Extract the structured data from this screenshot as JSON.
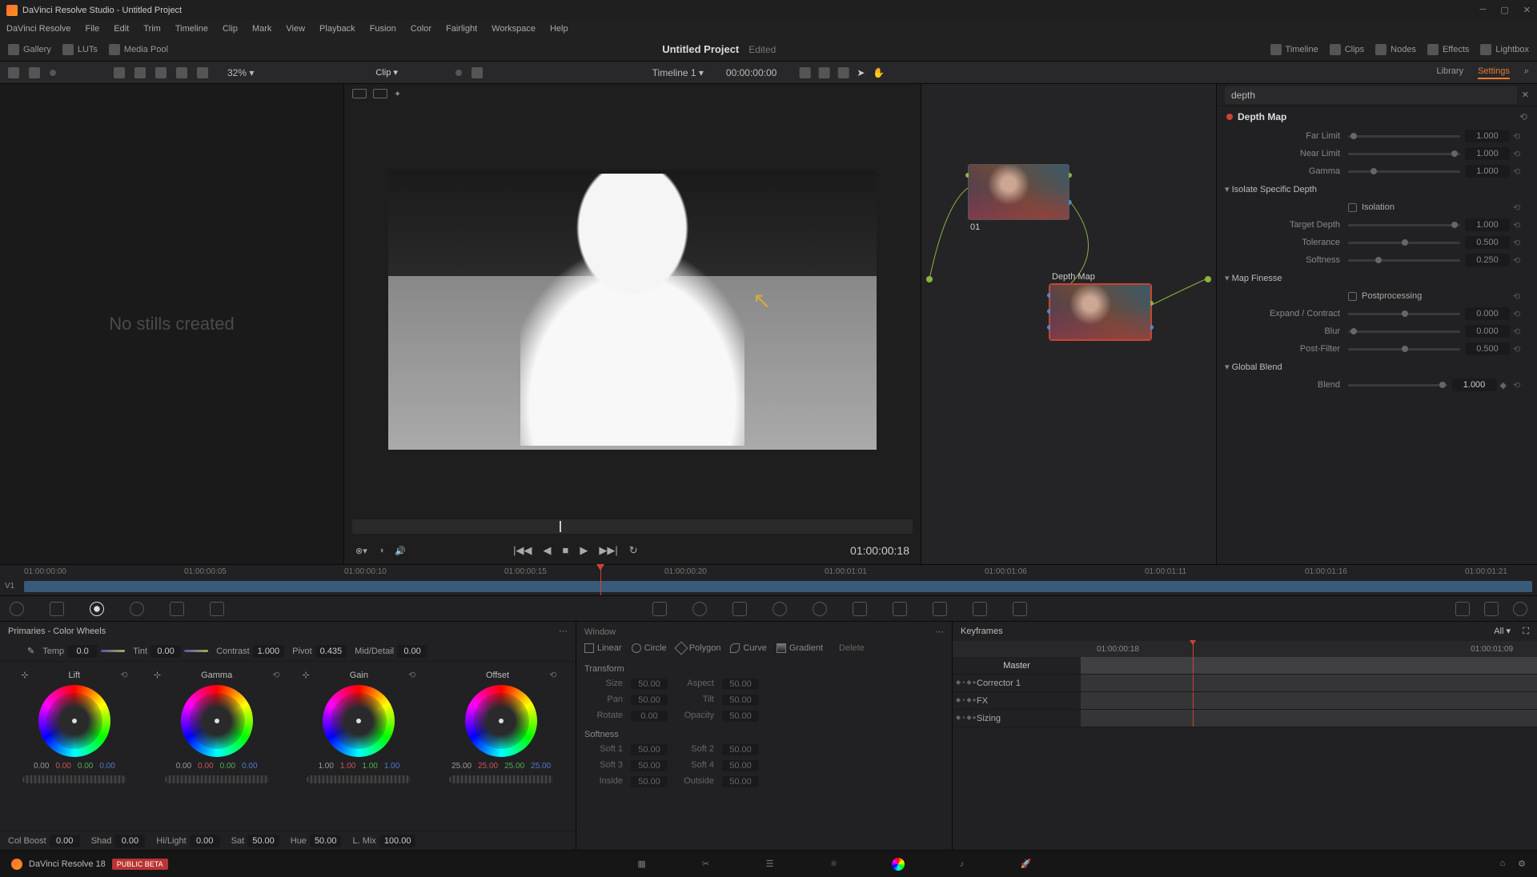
{
  "titlebar": {
    "text": "DaVinci Resolve Studio - Untitled Project"
  },
  "menu": [
    "DaVinci Resolve",
    "File",
    "Edit",
    "Trim",
    "Timeline",
    "Clip",
    "Mark",
    "View",
    "Playback",
    "Fusion",
    "Color",
    "Fairlight",
    "Workspace",
    "Help"
  ],
  "topToolbar": {
    "gallery": "Gallery",
    "luts": "LUTs",
    "mediapool": "Media Pool",
    "projectTitle": "Untitled Project",
    "edited": "Edited",
    "timeline": "Timeline",
    "clips": "Clips",
    "nodes": "Nodes",
    "effects": "Effects",
    "lightbox": "Lightbox"
  },
  "secondaryBar": {
    "zoom": "32%",
    "timelineName": "Timeline 1",
    "recordTC": "00:00:00:00",
    "clipMenu": "Clip",
    "library": "Library",
    "settings": "Settings"
  },
  "gallery": {
    "empty": "No stills created"
  },
  "viewer": {
    "timecode": "01:00:00:18"
  },
  "nodes": {
    "node1": {
      "num": "01"
    },
    "node2": {
      "label": "Depth Map"
    }
  },
  "settings": {
    "search": "depth",
    "effectName": "Depth Map",
    "farLimit": {
      "label": "Far Limit",
      "value": "1.000"
    },
    "nearLimit": {
      "label": "Near Limit",
      "value": "1.000"
    },
    "gamma": {
      "label": "Gamma",
      "value": "1.000"
    },
    "isolateHeader": "Isolate Specific Depth",
    "isolation": {
      "label": "Isolation"
    },
    "targetDepth": {
      "label": "Target Depth",
      "value": "1.000"
    },
    "tolerance": {
      "label": "Tolerance",
      "value": "0.500"
    },
    "softness": {
      "label": "Softness",
      "value": "0.250"
    },
    "finesseHeader": "Map Finesse",
    "postprocessing": {
      "label": "Postprocessing"
    },
    "expand": {
      "label": "Expand / Contract",
      "value": "0.000"
    },
    "blur": {
      "label": "Blur",
      "value": "0.000"
    },
    "postfilter": {
      "label": "Post-Filter",
      "value": "0.500"
    },
    "globalBlendHeader": "Global Blend",
    "blend": {
      "label": "Blend",
      "value": "1.000"
    }
  },
  "ruler": {
    "marks": [
      "01:00:00:00",
      "01:00:00:05",
      "01:00:00:10",
      "01:00:00:15",
      "01:00:00:20",
      "01:00:01:01",
      "01:00:01:06",
      "01:00:01:11",
      "01:00:01:16",
      "01:00:01:21"
    ],
    "track": "V1"
  },
  "primaries": {
    "title": "Primaries - Color Wheels",
    "temp": {
      "label": "Temp",
      "value": "0.0"
    },
    "tint": {
      "label": "Tint",
      "value": "0.00"
    },
    "contrast": {
      "label": "Contrast",
      "value": "1.000"
    },
    "pivot": {
      "label": "Pivot",
      "value": "0.435"
    },
    "middetail": {
      "label": "Mid/Detail",
      "value": "0.00"
    },
    "wheels": {
      "lift": {
        "name": "Lift",
        "vals": [
          "0.00",
          "0.00",
          "0.00",
          "0.00"
        ]
      },
      "gamma": {
        "name": "Gamma",
        "vals": [
          "0.00",
          "0.00",
          "0.00",
          "0.00"
        ]
      },
      "gain": {
        "name": "Gain",
        "vals": [
          "1.00",
          "1.00",
          "1.00",
          "1.00"
        ]
      },
      "offset": {
        "name": "Offset",
        "vals": [
          "25.00",
          "25.00",
          "25.00",
          "25.00"
        ]
      }
    },
    "colboost": {
      "label": "Col Boost",
      "value": "0.00"
    },
    "shad": {
      "label": "Shad",
      "value": "0.00"
    },
    "hilight": {
      "label": "Hi/Light",
      "value": "0.00"
    },
    "sat": {
      "label": "Sat",
      "value": "50.00"
    },
    "hue": {
      "label": "Hue",
      "value": "50.00"
    },
    "lmix": {
      "label": "L. Mix",
      "value": "100.00"
    }
  },
  "window": {
    "title": "Window",
    "shapes": {
      "linear": "Linear",
      "circle": "Circle",
      "polygon": "Polygon",
      "curve": "Curve",
      "gradient": "Gradient",
      "delete": "Delete"
    },
    "transform": {
      "header": "Transform",
      "size": {
        "label": "Size",
        "value": "50.00"
      },
      "aspect": {
        "label": "Aspect",
        "value": "50.00"
      },
      "pan": {
        "label": "Pan",
        "value": "50.00"
      },
      "tilt": {
        "label": "Tilt",
        "value": "50.00"
      },
      "rotate": {
        "label": "Rotate",
        "value": "0.00"
      },
      "opacity": {
        "label": "Opacity",
        "value": "50.00"
      }
    },
    "softness": {
      "header": "Softness",
      "soft1": {
        "label": "Soft 1",
        "value": "50.00"
      },
      "soft2": {
        "label": "Soft 2",
        "value": "50.00"
      },
      "soft3": {
        "label": "Soft 3",
        "value": "50.00"
      },
      "soft4": {
        "label": "Soft 4",
        "value": "50.00"
      },
      "inside": {
        "label": "Inside",
        "value": "50.00"
      },
      "outside": {
        "label": "Outside",
        "value": "50.00"
      }
    }
  },
  "keyframes": {
    "title": "Keyframes",
    "all": "All",
    "tc1": "01:00:00:18",
    "tc2": "01:00:01:09",
    "master": "Master",
    "corrector": "Corrector 1",
    "fx": "FX",
    "sizing": "Sizing"
  },
  "pageNav": {
    "brand": "DaVinci Resolve 18",
    "beta": "PUBLIC BETA"
  }
}
